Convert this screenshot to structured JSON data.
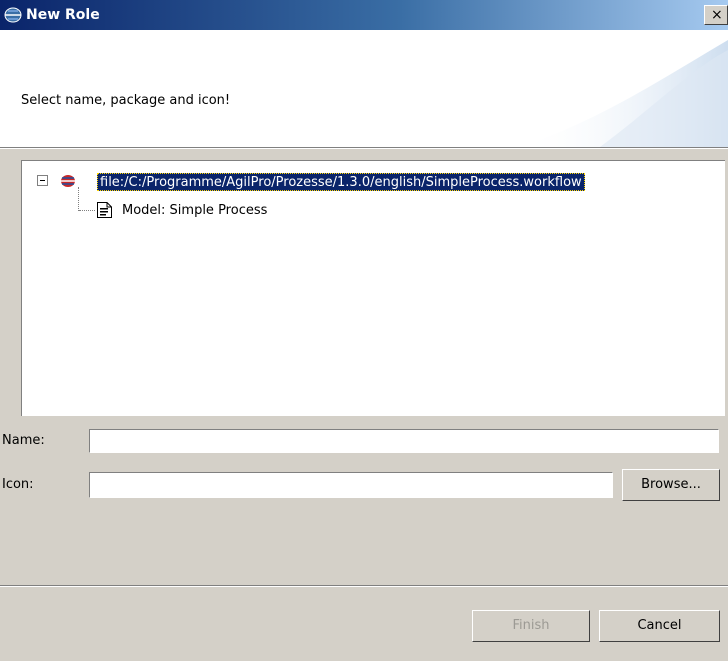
{
  "window": {
    "title": "New Role",
    "close_label": "×"
  },
  "header": {
    "message": "Select name, package and icon!"
  },
  "tree": {
    "root": {
      "label": "file:/C:/Programme/AgilPro/Prozesse/1.3.0/english/SimpleProcess.workflow",
      "expanded": true,
      "selected": true,
      "icon": "agilpro-eclipse-icon"
    },
    "children": [
      {
        "label": "Model: Simple Process",
        "icon": "document-icon"
      }
    ]
  },
  "form": {
    "name_label": "Name:",
    "name_value": "",
    "icon_label": "Icon:",
    "icon_value": "",
    "browse_label": "Browse..."
  },
  "buttons": {
    "finish_label": "Finish",
    "finish_enabled": false,
    "cancel_label": "Cancel"
  },
  "colors": {
    "titlebar_start": "#0a246a",
    "titlebar_end": "#a6caf0",
    "selection": "#0a246a",
    "dialog_bg": "#d4d0c8"
  }
}
